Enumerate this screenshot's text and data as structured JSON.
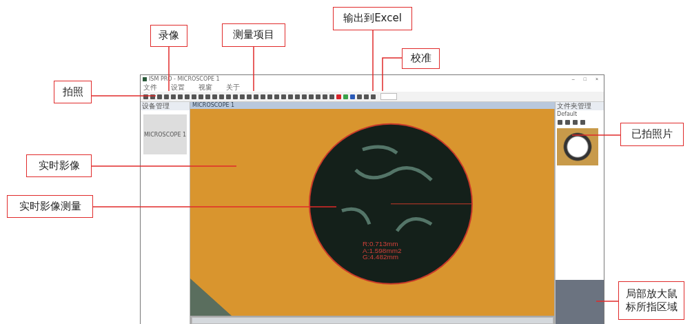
{
  "window": {
    "title": "ISM PRO - MICROSCOPE 1",
    "controls": [
      "–",
      "□",
      "×"
    ]
  },
  "menu": [
    "文件",
    "设置",
    "视窗",
    "关于"
  ],
  "left_panel": {
    "title": "设备管理",
    "device": "MICROSCOPE 1"
  },
  "viewer": {
    "tab": "MICROSCOPE 1",
    "measurement": [
      "R:0.713mm",
      "A:1.598mm2",
      "G:4.482mm"
    ]
  },
  "right_panel": {
    "title": "文件夹管理",
    "folder": "Default"
  },
  "callouts": [
    {
      "text": "录像"
    },
    {
      "text": "测量项目"
    },
    {
      "text": "输出到Excel"
    },
    {
      "text": "校准"
    },
    {
      "text": "拍照"
    },
    {
      "text": "实时影像"
    },
    {
      "text": "实时影像测量"
    },
    {
      "text": "已拍照片"
    },
    {
      "text": "局部放大鼠标所指区域"
    }
  ]
}
